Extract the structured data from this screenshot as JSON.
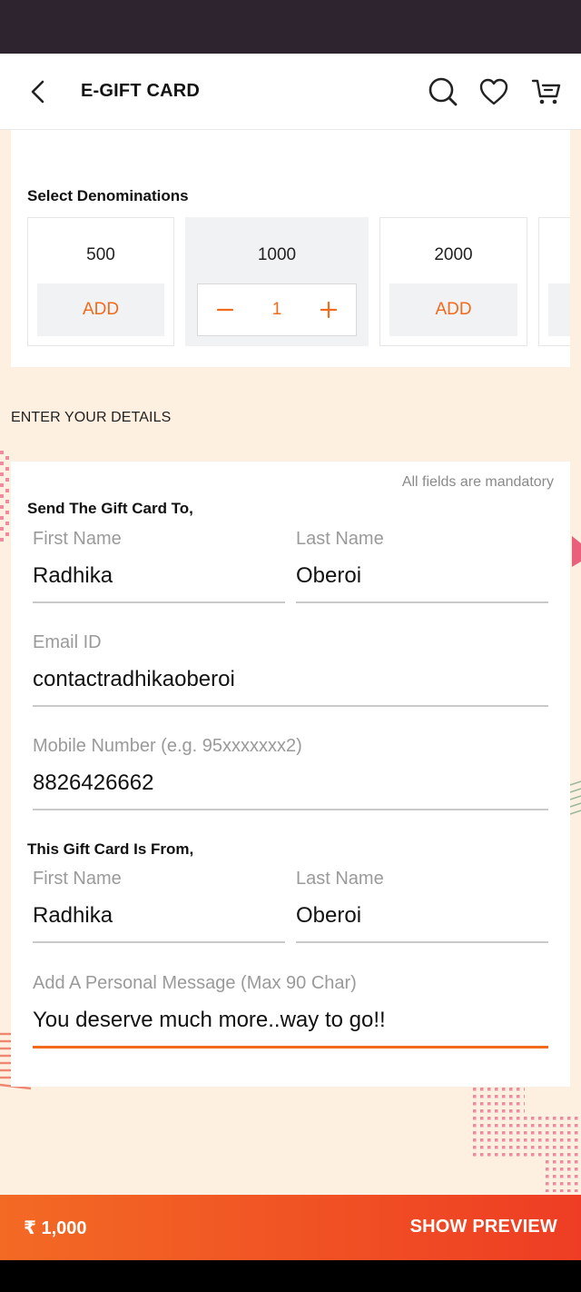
{
  "header": {
    "title": "E-GIFT CARD",
    "icons": [
      "back-arrow-icon",
      "search-icon",
      "heart-icon",
      "cart-icon"
    ]
  },
  "denominations": {
    "label": "Select Denominations",
    "items": [
      {
        "value": "500",
        "action": "ADD"
      },
      {
        "value": "1000",
        "quantity": "1"
      },
      {
        "value": "2000",
        "action": "ADD"
      }
    ]
  },
  "details": {
    "heading": "ENTER YOUR DETAILS",
    "mandatory_note": "All fields are mandatory",
    "recipient": {
      "label": "Send The Gift Card To,",
      "first_name": {
        "label": "First Name",
        "value": "Radhika"
      },
      "last_name": {
        "label": "Last Name",
        "value": "Oberoi"
      },
      "email": {
        "label": "Email ID",
        "value": "contactradhikaoberoi"
      },
      "mobile": {
        "label": "Mobile Number (e.g. 95xxxxxxx2)",
        "value": "8826426662"
      }
    },
    "sender": {
      "label": "This Gift Card Is From,",
      "first_name": {
        "label": "First Name",
        "value": "Radhika"
      },
      "last_name": {
        "label": "Last Name",
        "value": "Oberoi"
      }
    },
    "message": {
      "label": "Add A Personal Message (Max 90 Char)",
      "value": "You deserve much more..way to go!!"
    }
  },
  "footer": {
    "total": "₹ 1,000",
    "preview_label": "SHOW PREVIEW"
  },
  "colors": {
    "accent": "#f26a1b",
    "page_bg": "#fdf0e0",
    "status_bar": "#2e2430",
    "cta_gradient_start": "#f36a24",
    "cta_gradient_end": "#ee3d24"
  }
}
